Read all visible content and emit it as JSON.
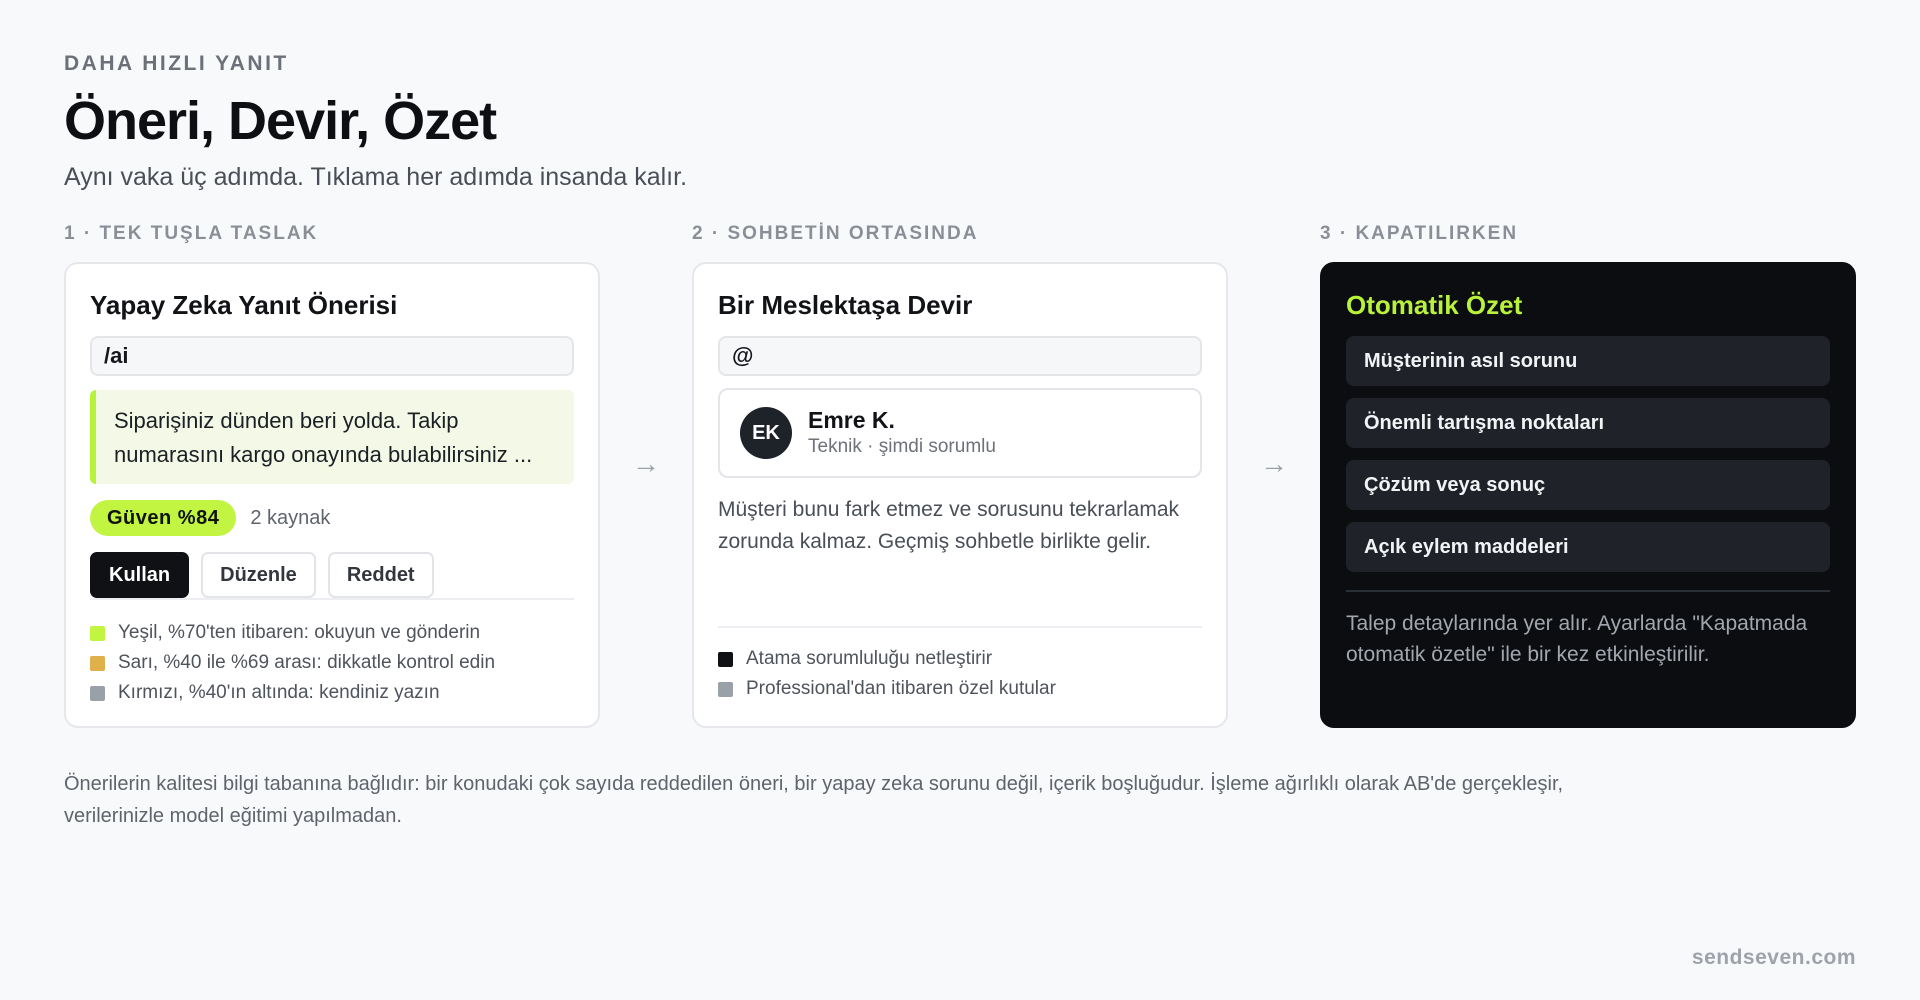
{
  "header": {
    "eyebrow": "DAHA HIZLI YANIT",
    "title": "Öneri, Devir, Özet",
    "subtitle": "Aynı vaka üç adımda. Tıklama her adımda insanda kalır."
  },
  "steps": {
    "suggest": {
      "label": "1 · TEK TUŞLA TASLAK",
      "title": "Yapay Zeka Yanıt Önerisi",
      "command": "/ai",
      "suggestion_line1": "Siparişiniz dünden beri yolda. Takip",
      "suggestion_line2": "numarasını kargo onayında bulabilirsiniz ...",
      "confidence": "Güven %84",
      "sources": "2 kaynak",
      "buttons": {
        "use": "Kullan",
        "edit": "Düzenle",
        "reject": "Reddet"
      },
      "legend": [
        {
          "text": "Yeşil, %70'ten itibaren: okuyun ve gönderin",
          "color": "#c2f542"
        },
        {
          "text": "Sarı, %40 ile %69 arası: dikkatle kontrol edin",
          "color": "#e0b04a"
        },
        {
          "text": "Kırmızı, %40'ın altında: kendiniz yazın",
          "color": "#9aa0a8"
        }
      ]
    },
    "handoff": {
      "label": "2 · SOHBETİN ORTASINDA",
      "title": "Bir Meslektaşa Devir",
      "mention": "@",
      "agent": {
        "initials": "EK",
        "name": "Emre K.",
        "role": "Teknik · şimdi sorumlu"
      },
      "description": "Müşteri bunu fark etmez ve sorusunu tekrarlamak zorunda kalmaz. Geçmiş sohbetle birlikte gelir.",
      "legend": [
        {
          "text": "Atama sorumluluğu netleştirir",
          "color": "#0f1114"
        },
        {
          "text": "Professional'dan itibaren özel kutular",
          "color": "#9aa0a8"
        }
      ]
    },
    "summary": {
      "label": "3 · KAPATILIRKEN",
      "title": "Otomatik Özet",
      "items": [
        "Müşterinin asıl sorunu",
        "Önemli tartışma noktaları",
        "Çözüm veya sonuç",
        "Açık eylem maddeleri"
      ],
      "note": "Talep detaylarında yer alır. Ayarlarda \"Kapatmada otomatik özetle\" ile bir kez etkinleştirilir."
    }
  },
  "arrow": "→",
  "footnote": "Önerilerin kalitesi bilgi tabanına bağlıdır: bir konudaki çok sayıda reddedilen öneri, bir yapay zeka sorunu değil, içerik boşluğudur. İşleme ağırlıklı olarak AB'de gerçekleşir, verilerinizle model eğitimi yapılmadan.",
  "brand": "sendseven.com",
  "colors": {
    "accent": "#c2f542",
    "dark_card": "#0c0d10",
    "summary_title": "#b8f23a"
  }
}
